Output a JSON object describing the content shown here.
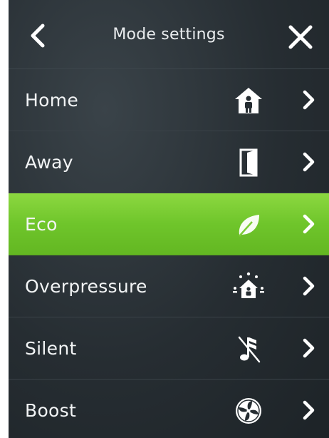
{
  "header": {
    "title": "Mode settings",
    "back_icon": "chevron-left-icon",
    "close_icon": "close-icon"
  },
  "menu": {
    "items": [
      {
        "label": "Home",
        "icon": "home-person-icon",
        "active": false
      },
      {
        "label": "Away",
        "icon": "door-open-icon",
        "active": false
      },
      {
        "label": "Eco",
        "icon": "leaf-icon",
        "active": true
      },
      {
        "label": "Overpressure",
        "icon": "house-pressure-icon",
        "active": false
      },
      {
        "label": "Silent",
        "icon": "muted-note-icon",
        "active": false
      },
      {
        "label": "Boost",
        "icon": "fan-icon",
        "active": false
      }
    ]
  },
  "colors": {
    "background": "#262d32",
    "active_green": "#72c62c",
    "text": "#f2f4f5"
  }
}
